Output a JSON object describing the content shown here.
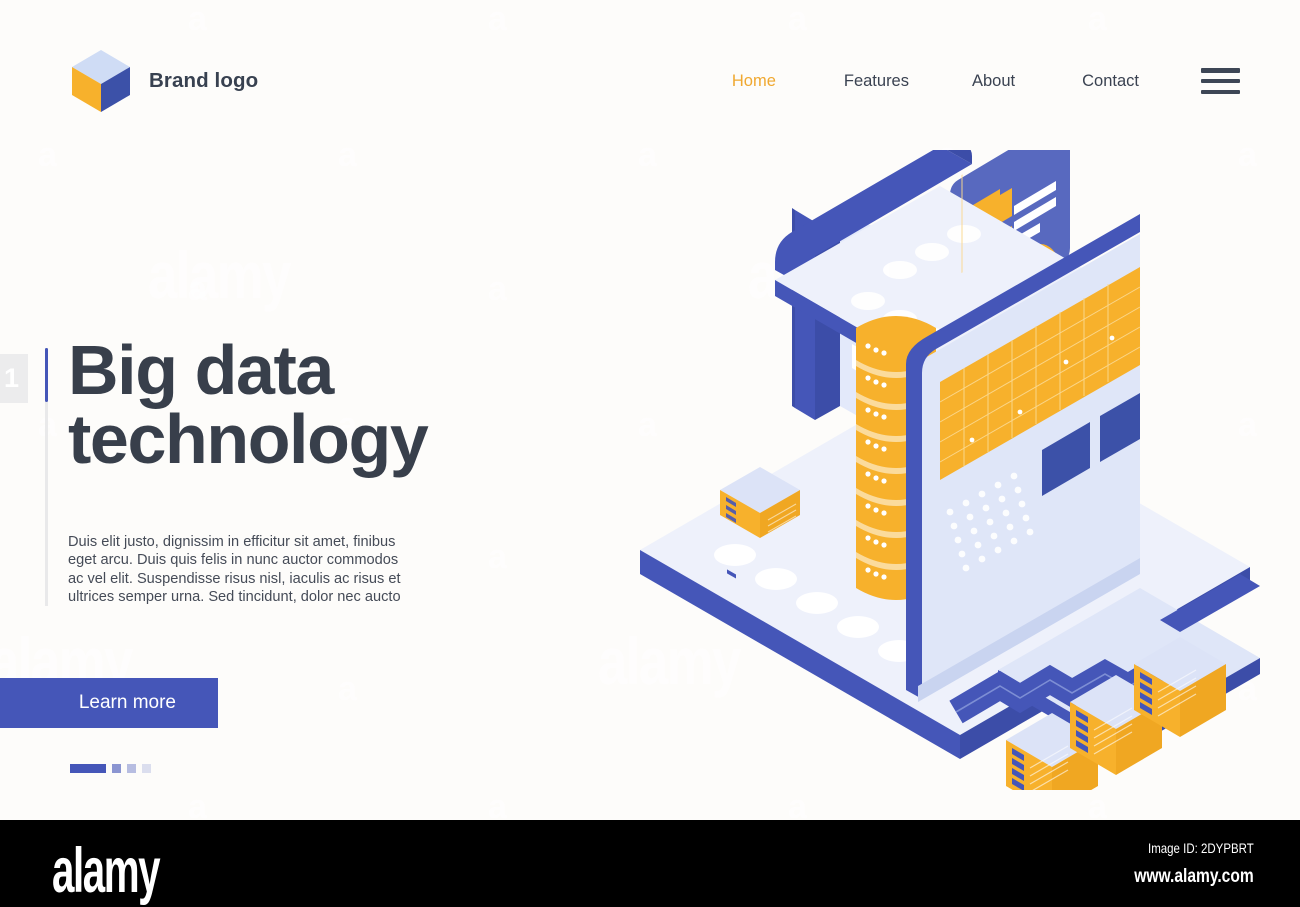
{
  "page": {
    "background_color": "#fdfcfa",
    "accent_blue": "#4556b8",
    "accent_orange": "#f7b12c",
    "heading_color": "#383f4b"
  },
  "header": {
    "brand": {
      "name": "Brand logo",
      "logo_icon": "isometric-cube-icon",
      "cube_top_color": "#cfdcf5",
      "cube_left_color": "#f7b12c",
      "cube_right_color": "#3c51a8"
    },
    "nav": {
      "items": [
        {
          "label": "Home",
          "active": true
        },
        {
          "label": "Features",
          "active": false
        },
        {
          "label": "About",
          "active": false
        },
        {
          "label": "Contact",
          "active": false
        }
      ],
      "menu_icon": "hamburger-menu-icon",
      "active_color": "#f0a830",
      "inactive_color": "#3a4251"
    }
  },
  "hero": {
    "slide_number": "1",
    "headline_line_1": "Big data",
    "headline_line_2": "technology",
    "body": "Duis elit justo, dignissim in efficitur sit amet, finibus eget arcu. Duis quis felis in nunc auctor commodos ac vel elit. Suspendisse risus nisl, iaculis ac risus et ultrices semper urna. Sed tincidunt, dolor nec aucto",
    "cta_label": "Learn more",
    "pagination": {
      "total": 4,
      "current": 1,
      "indicator_color": "#4556b8"
    }
  },
  "illustration": {
    "name": "isometric-big-data-server-illustration",
    "elements": [
      "floating-data-card",
      "server-rack-panel",
      "database-cylinder-stack",
      "storage-boxes",
      "base-platform"
    ],
    "card_folders": 3,
    "database_discs": 8,
    "storage_boxes": 3
  },
  "watermark": {
    "word": "alamy",
    "glyph": "a"
  },
  "footer": {
    "logo_text": "alamy",
    "image_id": "Image ID: 2DYPBRT",
    "url": "www.alamy.com",
    "background_color": "#000000"
  }
}
